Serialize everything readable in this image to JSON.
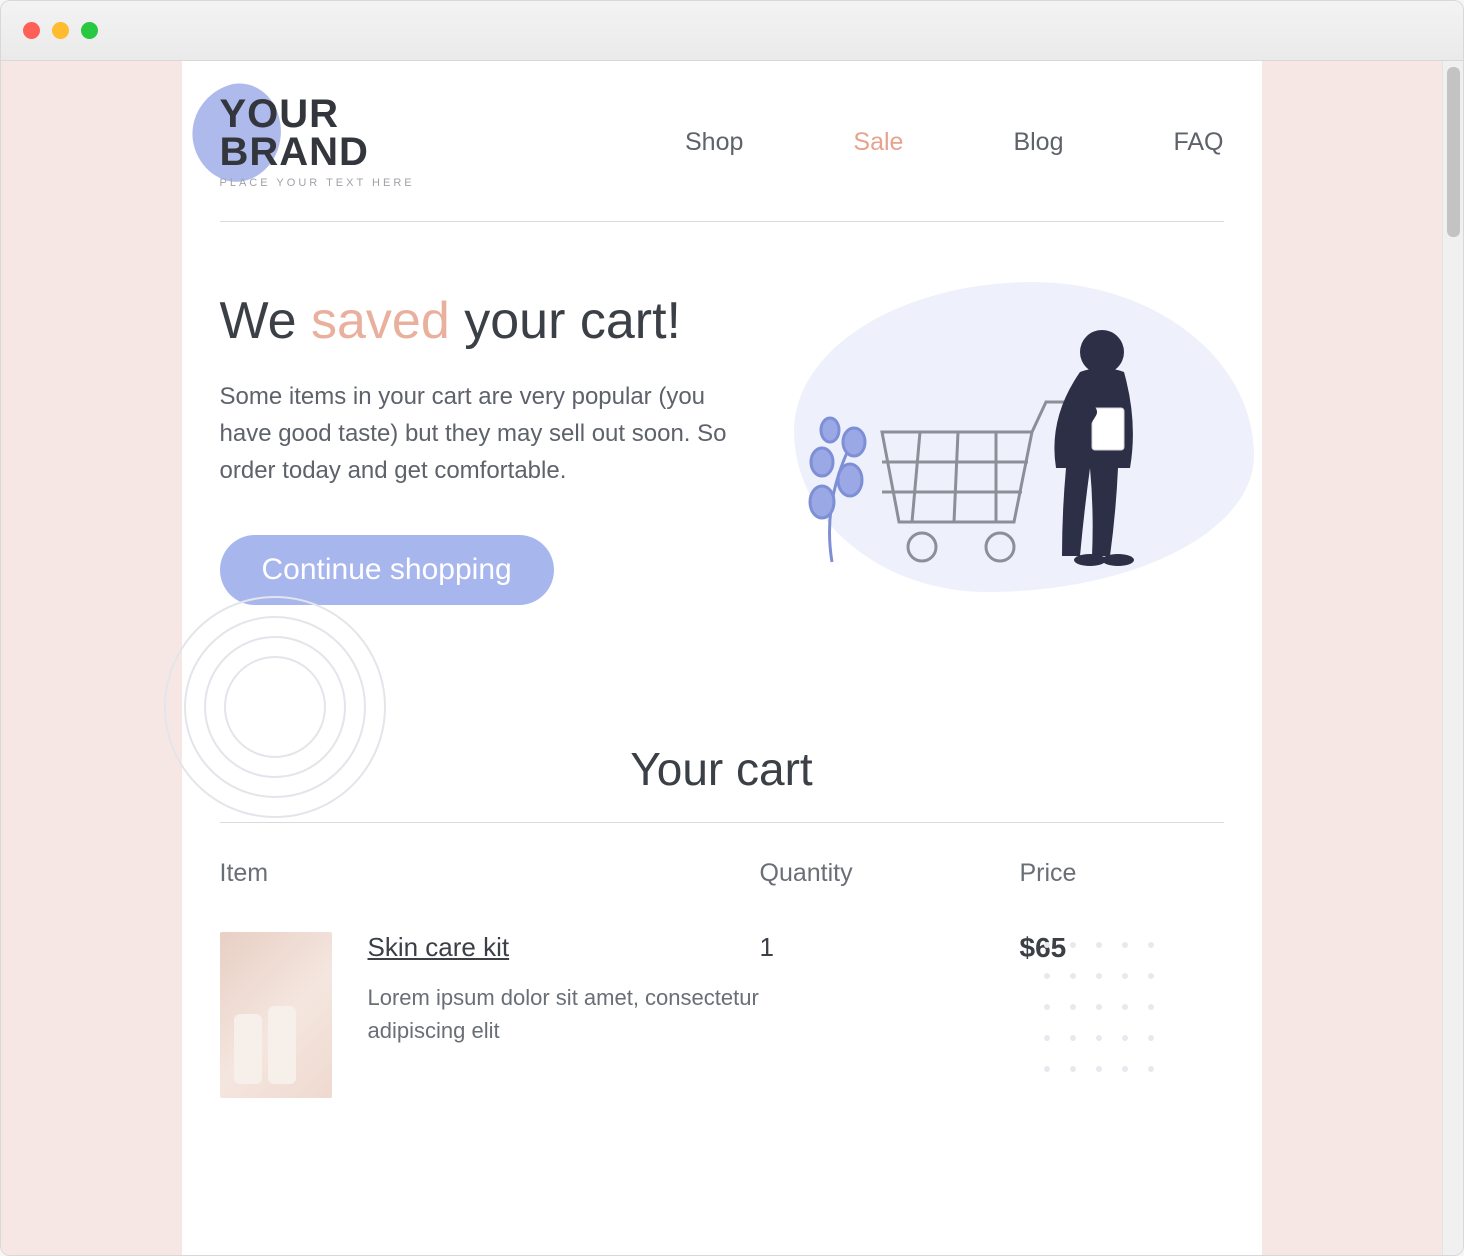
{
  "brand": {
    "line1": "YOUR",
    "line2": "BRAND",
    "tagline": "PLACE YOUR TEXT HERE"
  },
  "nav": {
    "shop": "Shop",
    "sale": "Sale",
    "blog": "Blog",
    "faq": "FAQ"
  },
  "hero": {
    "title_pre": "We ",
    "title_accent": "saved",
    "title_post": " your cart!",
    "body": "Some items in your cart are very popular (you have good taste) but they may sell out soon. So order today and get comfortable.",
    "cta": "Continue shopping"
  },
  "cart": {
    "heading": "Your cart",
    "cols": {
      "item": "Item",
      "qty": "Quantity",
      "price": "Price"
    },
    "items": [
      {
        "name": "Skin care kit",
        "desc": "Lorem ipsum dolor sit amet, consectetur adipiscing elit",
        "qty": "1",
        "price": "$65"
      }
    ]
  },
  "colors": {
    "accent_blue": "#a8b6ee",
    "accent_peach": "#eab09e",
    "bg_pink": "#f7e7e4"
  }
}
